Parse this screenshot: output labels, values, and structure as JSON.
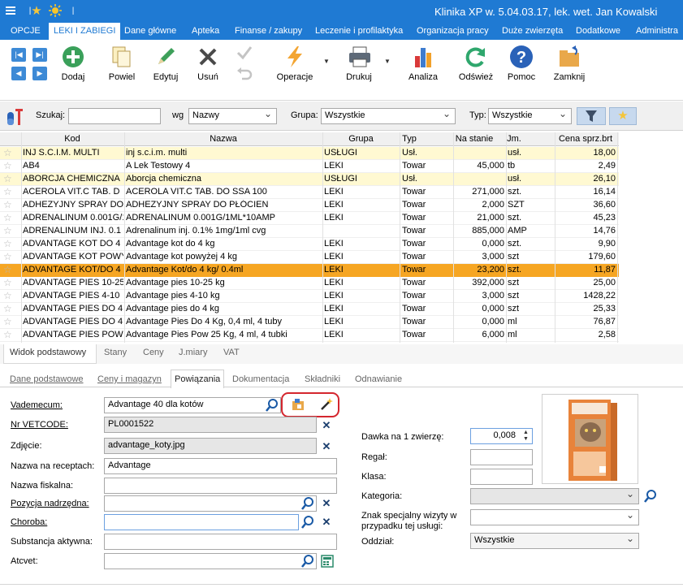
{
  "titlebar": {
    "title": "Klinika XP w. 5.04.03.17, lek. wet. Jan Kowalski"
  },
  "menu": [
    "OPCJE",
    "LEKI I ZABIEGI",
    "Dane główne",
    "Apteka",
    "Finanse / zakupy",
    "Leczenie i profilaktyka",
    "Organizacja pracy",
    "Duże zwierzęta",
    "Dodatkowe",
    "Administra"
  ],
  "ribbon": {
    "dodaj": "Dodaj",
    "powiel": "Powiel",
    "edytuj": "Edytuj",
    "usun": "Usuń",
    "operacje": "Operacje",
    "drukuj": "Drukuj",
    "analiza": "Analiza",
    "odswiez": "Odśwież",
    "pomoc": "Pomoc",
    "zamknij": "Zamknij"
  },
  "search": {
    "szukaj_label": "Szukaj:",
    "szukaj_value": "",
    "wg_label": "wg",
    "wg_value": "Nazwy",
    "grupa_label": "Grupa:",
    "grupa_value": "Wszystkie",
    "typ_label": "Typ:",
    "typ_value": "Wszystkie"
  },
  "grid": {
    "columns": [
      "Kod",
      "Nazwa",
      "Grupa",
      "Typ",
      "Na stanie",
      "Jm.",
      "Cena sprz.brt"
    ],
    "rows": [
      {
        "kod": "INJ S.C.I.M. MULTI",
        "nazwa": " inj s.c.i.m. multi",
        "grupa": "USŁUGI",
        "typ": "Usł.",
        "stan": "",
        "jm": "usł.",
        "cena": "18,00"
      },
      {
        "kod": "AB4",
        "nazwa": "A Lek Testowy 4",
        "grupa": "LEKI",
        "typ": "Towar",
        "stan": "45,000",
        "jm": "tb",
        "cena": "2,49"
      },
      {
        "kod": "ABORCJA CHEMICZNA",
        "nazwa": "Aborcja chemiczna",
        "grupa": "USŁUGI",
        "typ": "Usł.",
        "stan": "",
        "jm": "usł.",
        "cena": "26,10"
      },
      {
        "kod": "ACEROLA VIT.C TAB. D",
        "nazwa": "ACEROLA VIT.C TAB. DO SSA 100",
        "grupa": "LEKI",
        "typ": "Towar",
        "stan": "271,000",
        "jm": "szt.",
        "cena": "16,14"
      },
      {
        "kod": "ADHEZYJNY SPRAY DO P",
        "nazwa": "ADHEZYJNY SPRAY DO PŁÓCIEN",
        "grupa": "LEKI",
        "typ": "Towar",
        "stan": "2,000",
        "jm": "SZT",
        "cena": "36,60"
      },
      {
        "kod": "ADRENALINUM 0.001G/1",
        "nazwa": "ADRENALINUM 0.001G/1ML*10AMP",
        "grupa": "LEKI",
        "typ": "Towar",
        "stan": "21,000",
        "jm": "szt.",
        "cena": "45,23"
      },
      {
        "kod": "ADRENALINUM INJ. 0.1",
        "nazwa": "Adrenalinum inj. 0.1% 1mg/1ml cvg",
        "grupa": "",
        "typ": "Towar",
        "stan": "885,000",
        "jm": "AMP",
        "cena": "14,76"
      },
      {
        "kod": "ADVANTAGE KOT DO 4 K",
        "nazwa": "Advantage kot do 4 kg",
        "grupa": "LEKI",
        "typ": "Towar",
        "stan": "0,000",
        "jm": "szt.",
        "cena": "9,90"
      },
      {
        "kod": "ADVANTAGE KOT POWYŻ",
        "nazwa": "Advantage kot powyżej 4 kg",
        "grupa": "LEKI",
        "typ": "Towar",
        "stan": "3,000",
        "jm": "szt",
        "cena": "179,60"
      },
      {
        "kod": "ADVANTAGE KOT/DO 4 K",
        "nazwa": "Advantage Kot/do 4 kg/ 0.4ml",
        "grupa": "LEKI",
        "typ": "Towar",
        "stan": "23,200",
        "jm": "szt.",
        "cena": "11,87"
      },
      {
        "kod": "ADVANTAGE PIES 10-25",
        "nazwa": "Advantage pies 10-25 kg",
        "grupa": "LEKI",
        "typ": "Towar",
        "stan": "392,000",
        "jm": "szt",
        "cena": "25,00"
      },
      {
        "kod": "ADVANTAGE PIES 4-10",
        "nazwa": "Advantage pies 4-10 kg",
        "grupa": "LEKI",
        "typ": "Towar",
        "stan": "3,000",
        "jm": "szt",
        "cena": "1428,22"
      },
      {
        "kod": "ADVANTAGE PIES DO 4",
        "nazwa": "Advantage pies do 4 kg",
        "grupa": "LEKI",
        "typ": "Towar",
        "stan": "0,000",
        "jm": "szt",
        "cena": "25,33"
      },
      {
        "kod": "ADVANTAGE PIES DO 4!",
        "nazwa": "Advantage Pies Do 4 Kg, 0,4 ml, 4 tuby",
        "grupa": "LEKI",
        "typ": "Towar",
        "stan": "0,000",
        "jm": "ml",
        "cena": "76,87"
      },
      {
        "kod": "ADVANTAGE PIES POW 3",
        "nazwa": "Advantage Pies Pow 25 Kg, 4 ml, 4 tubki",
        "grupa": "LEKI",
        "typ": "Towar",
        "stan": "6,000",
        "jm": "ml",
        "cena": "2,58"
      }
    ]
  },
  "tabs1": [
    "Widok podstawowy",
    "Stany",
    "Ceny",
    "J.miary",
    "VAT"
  ],
  "tabs2": [
    "Dane podstawowe",
    "Ceny i magazyn",
    "Powiązania",
    "Dokumentacja",
    "Składniki",
    "Odnawianie"
  ],
  "form": {
    "vademecum_label": "Vademecum:",
    "vademecum_value": "Advantage 40 dla kotów",
    "vetcode_label": "Nr VETCODE:",
    "vetcode_value": "PL0001522",
    "zdjecie_label": "Zdjęcie:",
    "zdjecie_value": "advantage_koty.jpg",
    "nazwa_recepta_label": "Nazwa na receptach:",
    "nazwa_recepta_value": "Advantage",
    "nazwa_fiskalna_label": "Nazwa fiskalna:",
    "nazwa_fiskalna_value": "",
    "pozycja_label": "Pozycja nadrzędna:",
    "pozycja_value": "",
    "choroba_label": "Choroba:",
    "choroba_value": "",
    "substancja_label": "Substancja aktywna:",
    "substancja_value": "",
    "atcvet_label": "Atcvet:",
    "atcvet_value": "",
    "dawka_label": "Dawka na 1 zwierzę:",
    "dawka_value": "0,008",
    "regal_label": "Regał:",
    "regal_value": "",
    "klasa_label": "Klasa:",
    "klasa_value": "",
    "kategoria_label": "Kategoria:",
    "kategoria_value": "",
    "znak_label1": "Znak specjalny wizyty w",
    "znak_label2": "przypadku tej usługi:",
    "znak_value": "",
    "oddzial_label": "Oddział:",
    "oddzial_value": "Wszystkie"
  },
  "colors": {
    "accent": "#1f7ad3",
    "row_highlight": "#fff9d2",
    "row_selected": "#f6a623",
    "annotation": "#d4262e"
  }
}
